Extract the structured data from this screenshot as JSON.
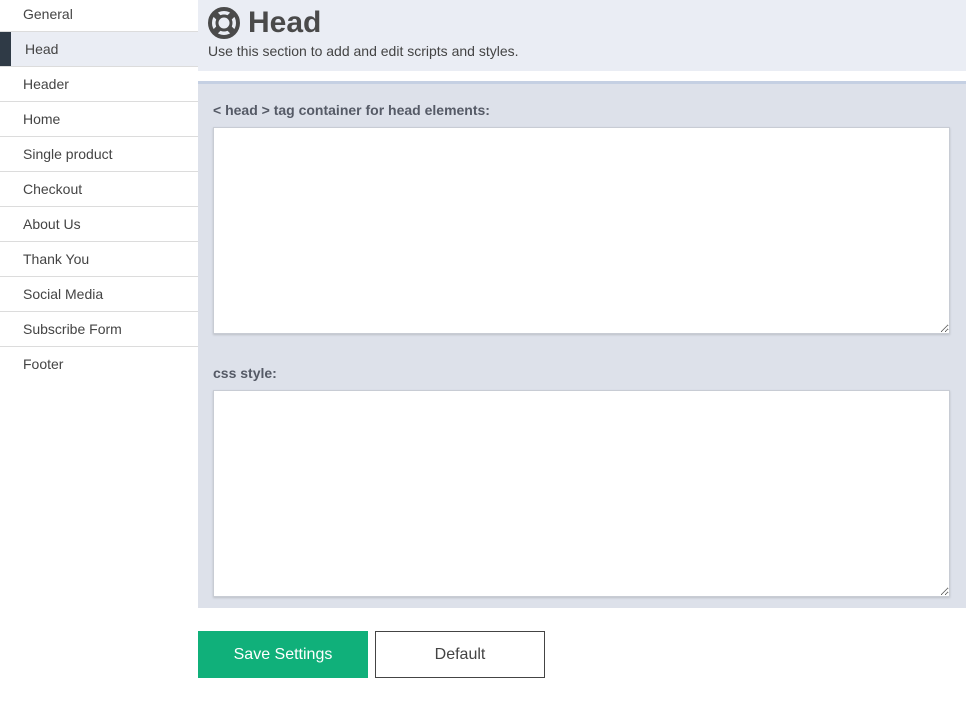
{
  "sidebar": {
    "items": [
      {
        "label": "General",
        "active": false
      },
      {
        "label": "Head",
        "active": true
      },
      {
        "label": "Header",
        "active": false
      },
      {
        "label": "Home",
        "active": false
      },
      {
        "label": "Single product",
        "active": false
      },
      {
        "label": "Checkout",
        "active": false
      },
      {
        "label": "About Us",
        "active": false
      },
      {
        "label": "Thank You",
        "active": false
      },
      {
        "label": "Social Media",
        "active": false
      },
      {
        "label": "Subscribe Form",
        "active": false
      },
      {
        "label": "Footer",
        "active": false
      }
    ]
  },
  "header": {
    "icon": "lifebuoy-icon",
    "title": "Head",
    "subtitle": "Use this section to add and edit scripts and styles."
  },
  "fields": {
    "head_container": {
      "label": "< head > tag container for head elements:",
      "value": ""
    },
    "css_style": {
      "label": "css style:",
      "value": ""
    }
  },
  "actions": {
    "save_label": "Save Settings",
    "default_label": "Default"
  },
  "colors": {
    "accent": "#10b07a",
    "active_marker": "#2f3a46",
    "header_bg": "#eaedf4",
    "panel_bg": "#dde1ea"
  }
}
